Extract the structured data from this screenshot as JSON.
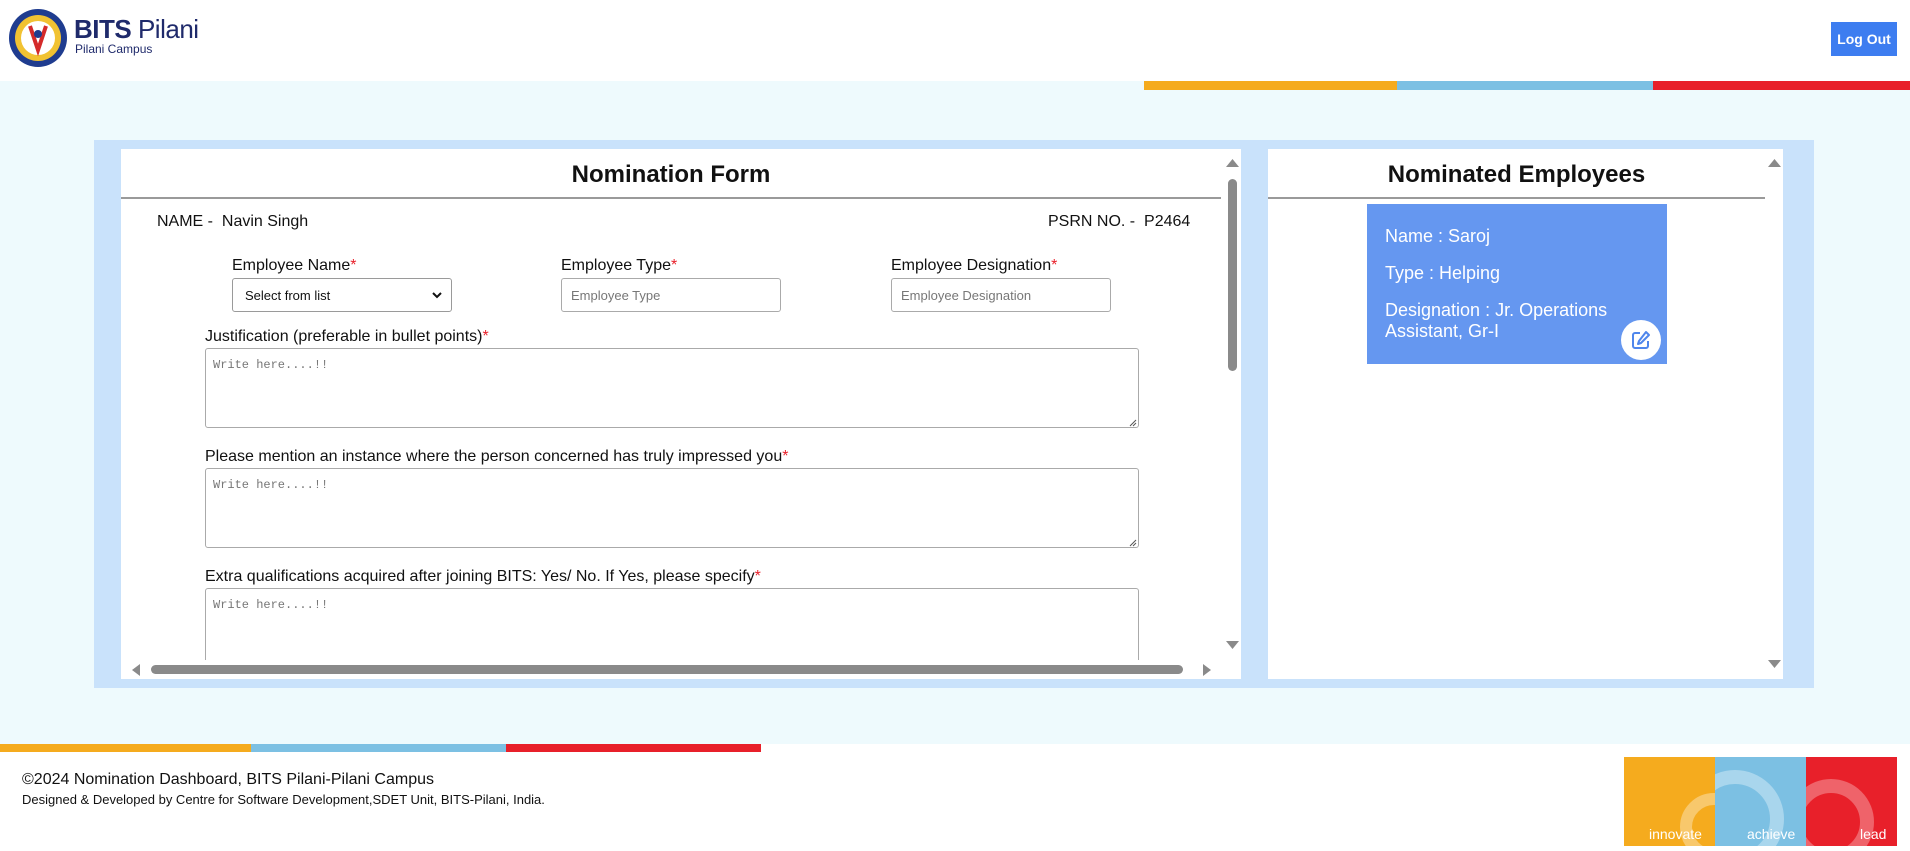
{
  "header": {
    "brand_bold": "BITS",
    "brand_rest": " Pilani",
    "brand_sub": "Pilani Campus",
    "logout_label": "Log Out"
  },
  "form": {
    "title": "Nomination Form",
    "name_label": "NAME -",
    "name_value": "Navin Singh",
    "psrn_label": "PSRN NO. -",
    "psrn_value": "P2464",
    "employee_name_label": "Employee Name",
    "employee_name_select": "Select from list",
    "employee_type_label": "Employee Type",
    "employee_type_placeholder": "Employee Type",
    "employee_designation_label": "Employee Designation",
    "employee_designation_placeholder": "Employee Designation",
    "justification_label": "Justification (preferable in bullet points)",
    "instance_label": "Please mention an instance where the person concerned has truly impressed you",
    "qualifications_label": "Extra qualifications acquired after joining BITS: Yes/ No. If Yes, please specify",
    "textarea_placeholder": "Write here....!!",
    "required_mark": "*"
  },
  "nominated": {
    "title": "Nominated Employees",
    "employees": [
      {
        "name": "Name : Saroj",
        "type": "Type : Helping",
        "designation": "Designation : Jr. Operations Assistant, Gr-I"
      }
    ]
  },
  "footer": {
    "copyright": "©2024 Nomination Dashboard, BITS Pilani-Pilani Campus",
    "credit": "Designed & Developed by Centre for Software Development,SDET Unit, BITS-Pilani, India.",
    "tiles": [
      "innovate",
      "achieve",
      "lead"
    ]
  },
  "colors": {
    "brand_blue": "#1f2a6b",
    "button_blue": "#3d7df0",
    "card_blue": "#6597f0",
    "stripe_yellow": "#f5ab1e",
    "stripe_blue": "#7cc0e3",
    "stripe_red": "#e8202a",
    "page_bg": "#eefafd",
    "frame_bg": "#c9e2fb"
  },
  "icons": [
    "bits-pilani-logo",
    "chevron-down-icon",
    "edit-icon",
    "resize-grip-icon",
    "gear-icon"
  ]
}
